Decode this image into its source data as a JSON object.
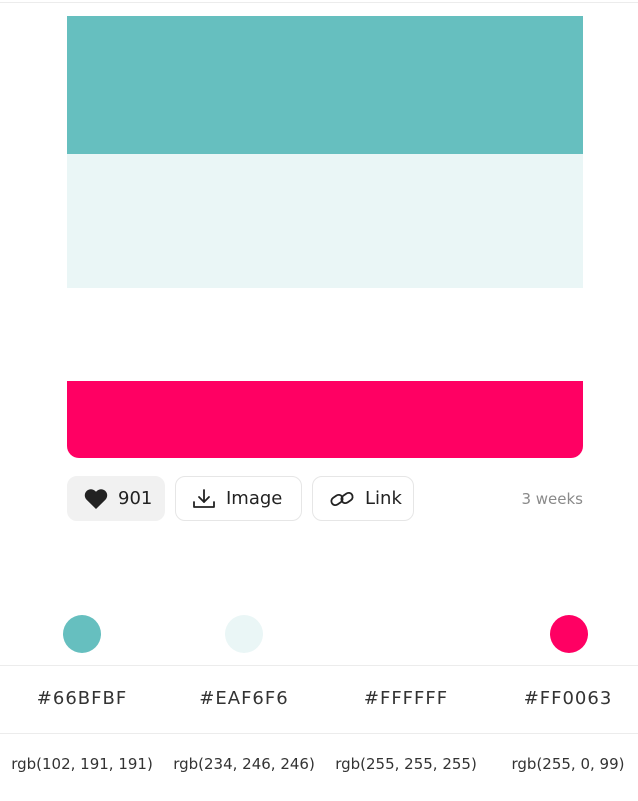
{
  "palette": {
    "colors": [
      "#66BFBF",
      "#EAF6F6",
      "#FFFFFF",
      "#FF0063"
    ]
  },
  "actions": {
    "like_count": "901",
    "image_label": "Image",
    "link_label": "Link",
    "age": "3 weeks"
  },
  "swatches": [
    {
      "hex": "#66BFBF",
      "rgb": "rgb(102, 191, 191)"
    },
    {
      "hex": "#EAF6F6",
      "rgb": "rgb(234, 246, 246)"
    },
    {
      "hex": "#FFFFFF",
      "rgb": "rgb(255, 255, 255)"
    },
    {
      "hex": "#FF0063",
      "rgb": "rgb(255, 0, 99)"
    }
  ],
  "icons": [
    "heart-icon",
    "download-icon",
    "link-icon"
  ]
}
